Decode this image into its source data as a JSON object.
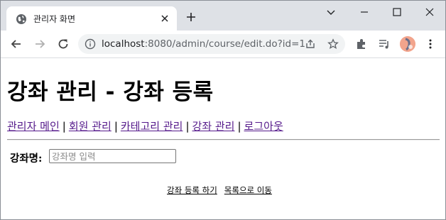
{
  "browser": {
    "tab_title": "관리자 화면",
    "url_host": "localhost",
    "url_rest": ":8080/admin/course/edit.do?id=1"
  },
  "page": {
    "heading": "강좌 관리 - 강좌 등록",
    "nav": {
      "items": [
        "관리자 메인",
        "회원 관리",
        "카테고리 관리",
        "강좌 관리",
        "로그아웃"
      ],
      "separator": "|"
    },
    "form": {
      "label": "강좌명:",
      "placeholder": "강좌명 입력",
      "value": ""
    },
    "actions": {
      "submit": "강좌 등록 하기",
      "list": "목록으로 이동"
    }
  },
  "colors": {
    "tabstrip": "#dee1e6",
    "visited_link": "#551a8b"
  }
}
